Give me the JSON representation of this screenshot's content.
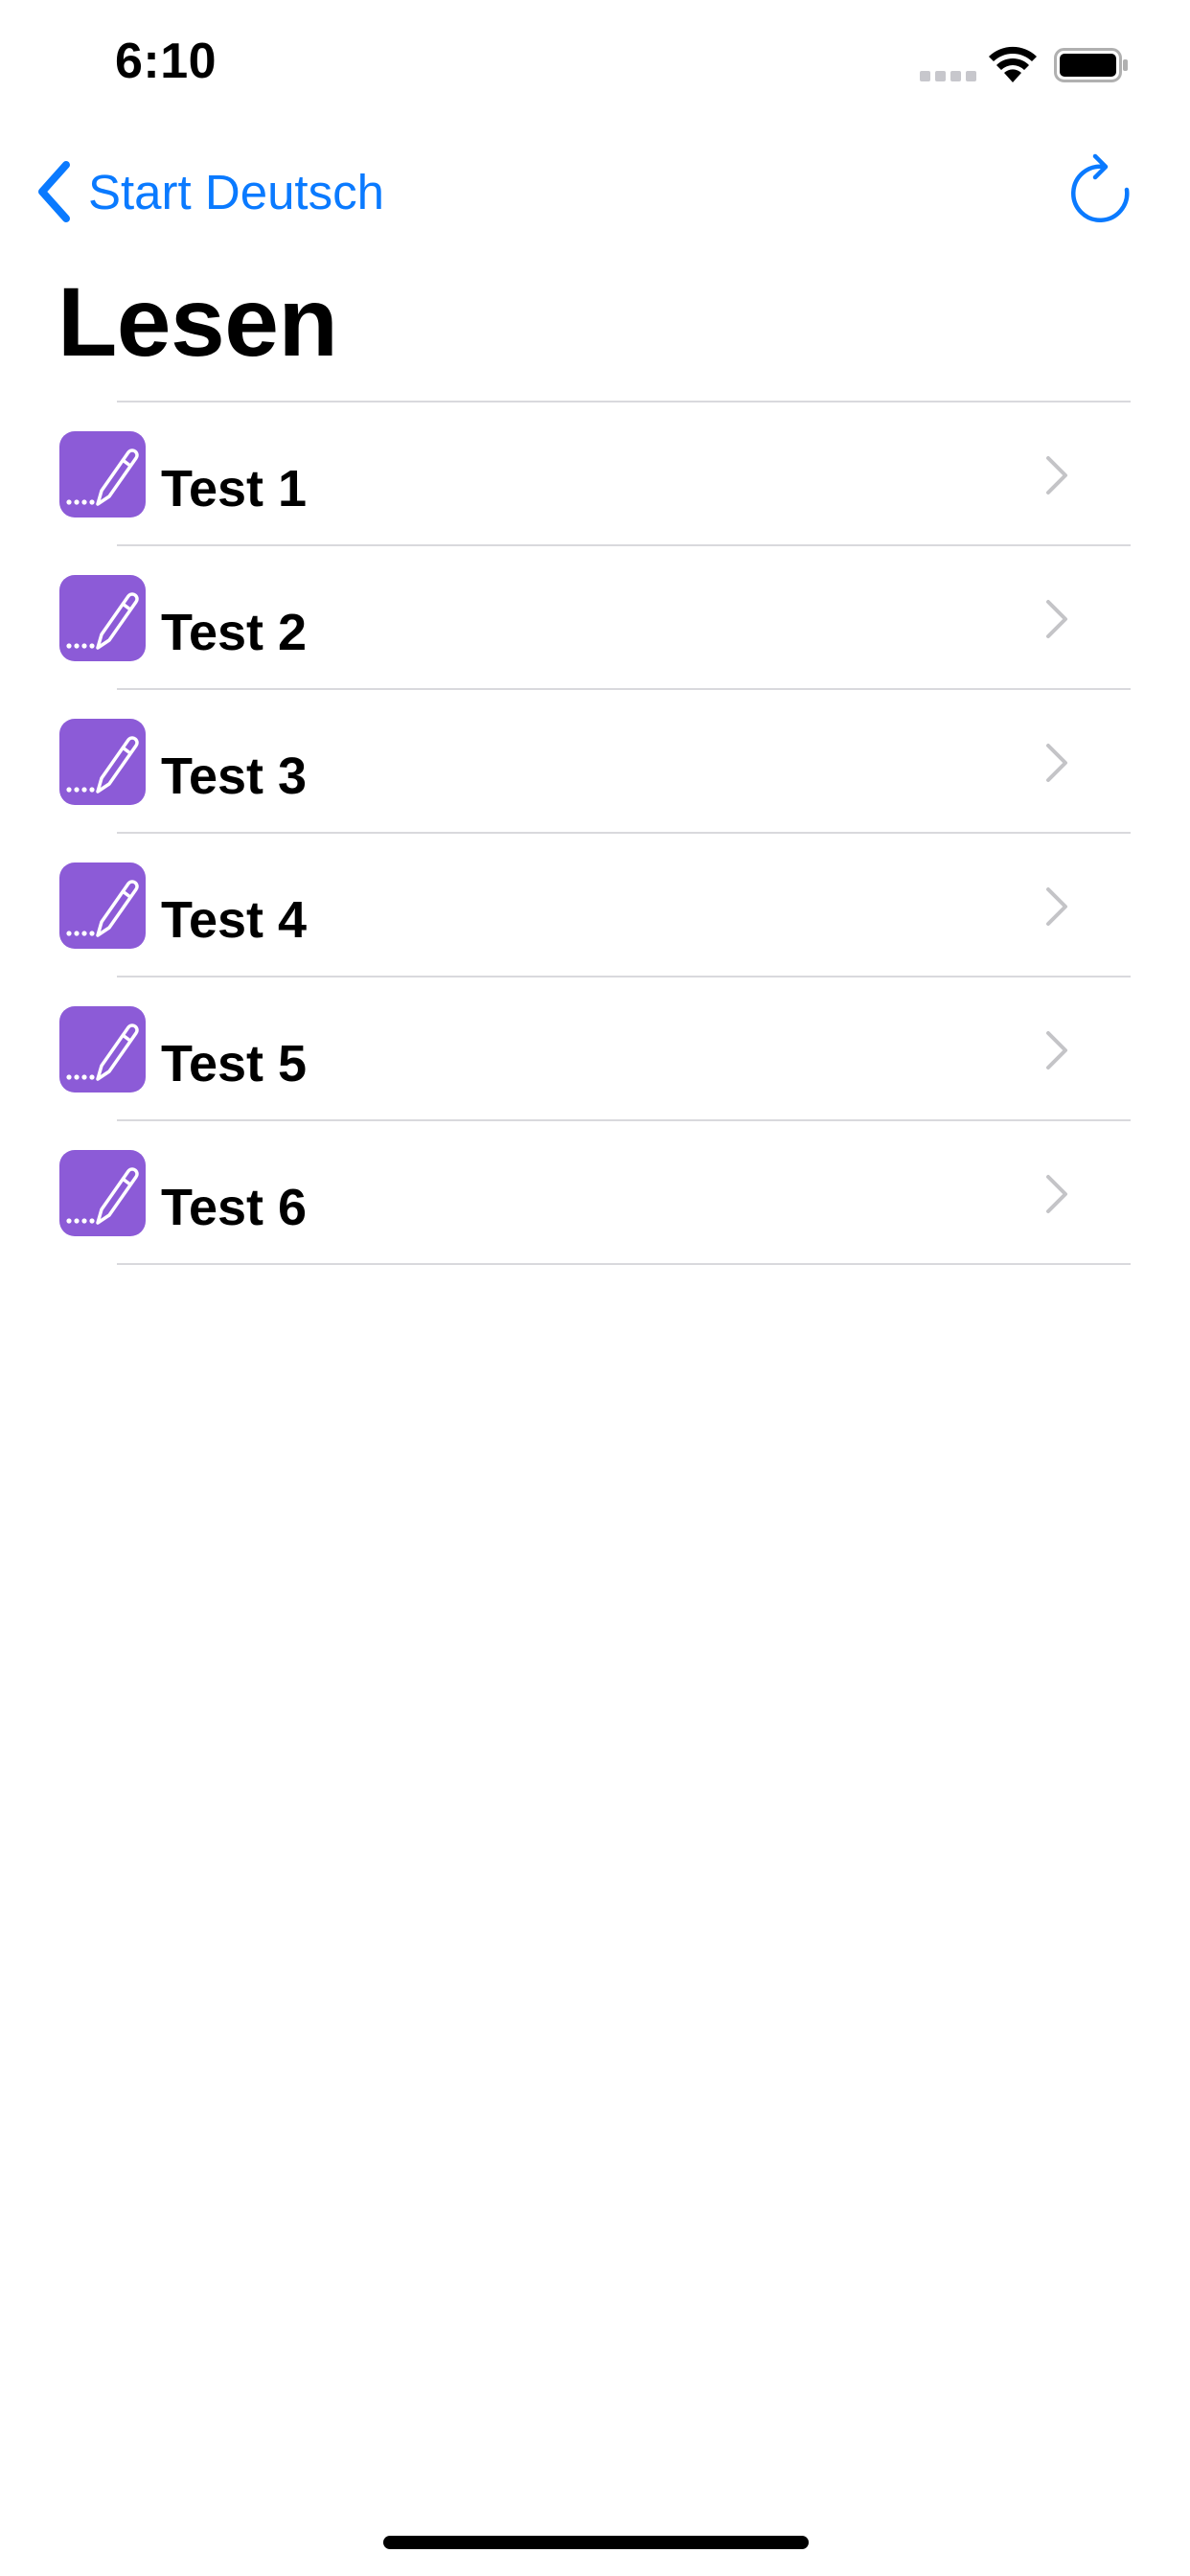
{
  "status_bar": {
    "time": "6:10",
    "signal_icon": "signal-dots-icon",
    "wifi_icon": "wifi-icon",
    "battery_icon": "battery-icon"
  },
  "nav": {
    "back_label": "Start Deutsch",
    "back_icon": "chevron-left-icon",
    "refresh_icon": "refresh-icon",
    "accent_color": "#0a7aff"
  },
  "page": {
    "title": "Lesen"
  },
  "list": {
    "icon": "pencil-icon",
    "icon_color": "#8c5bd7",
    "items": [
      {
        "label": "Test 1"
      },
      {
        "label": "Test 2"
      },
      {
        "label": "Test 3"
      },
      {
        "label": "Test 4"
      },
      {
        "label": "Test 5"
      },
      {
        "label": "Test 6"
      }
    ]
  }
}
